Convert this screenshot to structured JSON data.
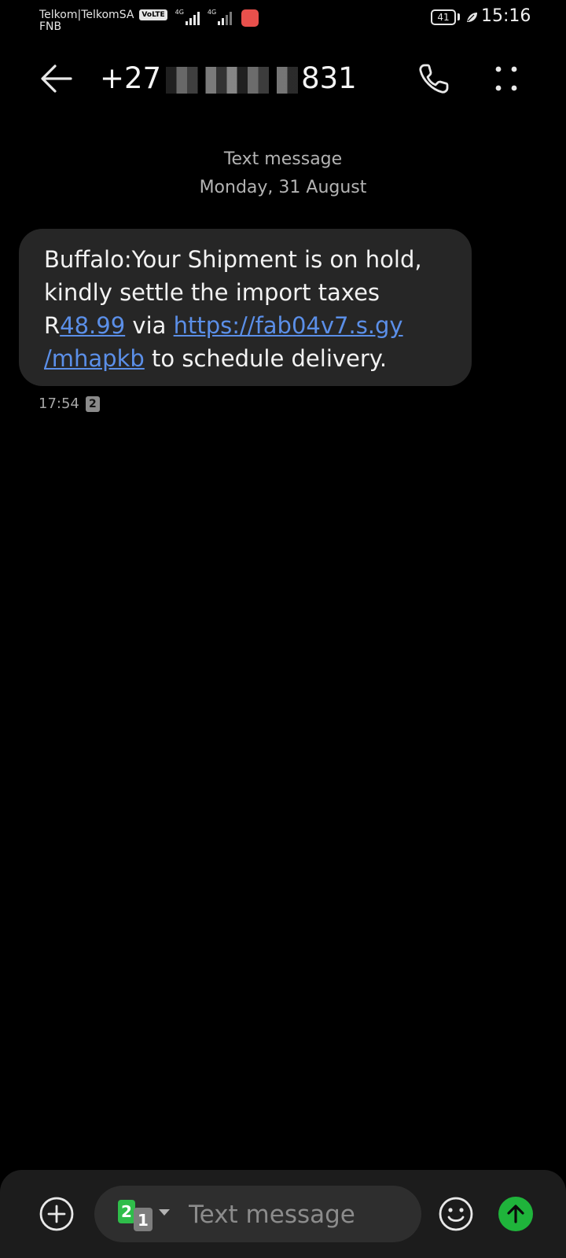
{
  "status_bar": {
    "carrier_primary": "Telkom|TelkomSA",
    "volte_label": "VoLTE",
    "network_1": "4G",
    "network_2": "4G",
    "carrier_secondary": "FNB",
    "battery_level": "41",
    "time": "15:16",
    "notification_icon": "huawei-store-icon"
  },
  "header": {
    "back_icon": "back-arrow-icon",
    "contact_prefix": "+27",
    "contact_suffix": "831",
    "call_icon": "phone-icon",
    "more_icon": "more-options-icon"
  },
  "conversation": {
    "message_type": "Text message",
    "date": "Monday, 31 August",
    "messages": [
      {
        "text_part1": "Buffalo:Your Shipment is on hold, kindly settle the import taxes R",
        "amount_link": "48.99",
        "text_part2": " via ",
        "url_link_line1": "https://fab04v7.s.gy",
        "url_link_line2": "/mhapkb",
        "text_part3": " to schedule delivery.",
        "time": "17:54",
        "sim": "2"
      }
    ]
  },
  "composer": {
    "add_icon": "add-circle-icon",
    "sim_primary": "2",
    "sim_secondary": "1",
    "placeholder": "Text message",
    "emoji_icon": "emoji-icon",
    "send_icon": "send-arrow-icon",
    "send_color": "#1fb43b"
  },
  "colors": {
    "background": "#000000",
    "bubble": "#262626",
    "link": "#5b8fe8",
    "composer_bar": "#1c1c1c",
    "input_pill": "#2e2e2e"
  }
}
